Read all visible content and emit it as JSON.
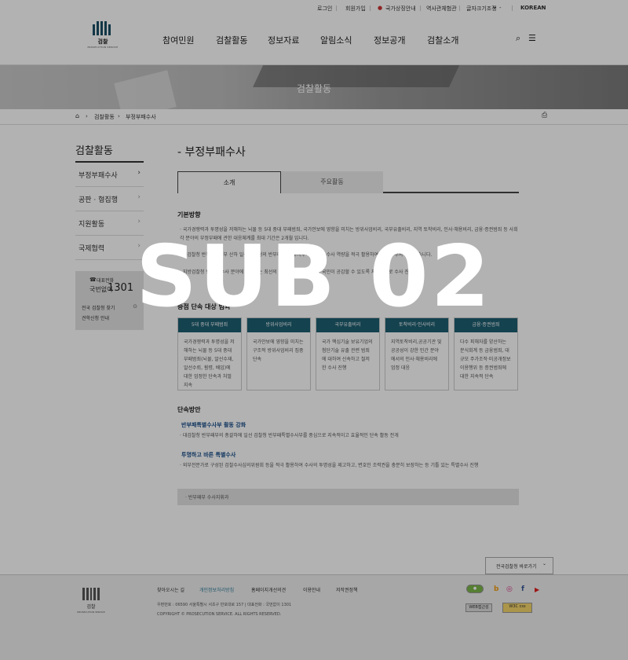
{
  "utility": {
    "login": "로그인",
    "join": "회원가입",
    "flag_icon": "korea-flag-icon",
    "national_info": "국가상징안내",
    "history": "역사관체험관",
    "font_size_label": "글자크기조정",
    "font_plus": "+",
    "font_minus": "-",
    "language": "KOREAN"
  },
  "logo": {
    "name": "검찰",
    "sub": "PROSECUTION SERVICE"
  },
  "gnb": [
    "참여민원",
    "검찰활동",
    "정보자료",
    "알림소식",
    "정보공개",
    "검찰소개"
  ],
  "banner": {
    "title": "검찰활동"
  },
  "breadcrumb": [
    "검찰활동",
    "부정부패수사"
  ],
  "snb": {
    "title": "검찰활동",
    "items": [
      "부정부패수사",
      "공판 · 형집행",
      "지원활동",
      "국제협력"
    ]
  },
  "contact": {
    "label": "대표전화",
    "sublabel": "국번없이",
    "number": "1301",
    "link1": "전국 검찰청 찾기",
    "link2": "견학신청 안내"
  },
  "page": {
    "title": "- 부정부패수사",
    "tabs": [
      "소개",
      "주요활동"
    ]
  },
  "basic": {
    "heading": "기본방향",
    "p1": "· 국가경쟁력과 투명성을 저해하는 뇌물 등 5대 중대 부패범죄, 국가안보에 영향을 미치는 방위사업비리, 국부유출비리, 지역 토착비리, 인사·채용비리, 금융·증권범죄 등 사회 각 분야의 부정부패에 관한 대응체계를 최대 기간은 2개월 입니다.",
    "p2": "· 대검찰청 반부패강력부 산하 일선 검찰청의 반부패 전담 수사부서와 관련 수사 역량을 적극 활용하여 철저히 수사하고 있습니다.",
    "p3": "· 지방검찰청 반부패 수사 분야에 대하여는 최선의 수사 역량을 집중하여 국민이 공감할 수 있도록 지속적으로 수사 진행"
  },
  "crimes": {
    "heading": "중점 단속 대상 범죄",
    "cards": [
      {
        "title": "5대 중대 부패범죄",
        "body": "국가경쟁력과 투명성을 저해하는 뇌물 등 5대 중대 부패범죄(뇌물, 알선수재, 알선수뢰, 횡령, 배임)에 대한 엄정한 단속과 처벌 지속"
      },
      {
        "title": "방위사업비리",
        "body": "국가안보에 영향을 미치는 구조적 방위사업비리 집중 단속"
      },
      {
        "title": "국부유출비리",
        "body": "국가 핵심기술 보유기업의 첨단기술 유출 관련 범죄에 대하여 신속하고 철저한 수사 진행"
      },
      {
        "title": "토착비리·인사비리",
        "body": "지역토착비리,공공기관 및 공공성이 강한 민간 분야에서의 인사·채용비리에 엄정 대응"
      },
      {
        "title": "금융·증권범죄",
        "body": "다수 피해자를 양산하는 분식회계 등 금융범죄, 대규모 주가조작·미공개정보이용행위 등 증권범죄에 대한 지속적 단속"
      }
    ]
  },
  "measures": {
    "heading": "단속방안",
    "h1": "반부패특별수사부 활동 강화",
    "p1": "· 대검찰청 반부패부의 총괄하에 일선 검찰청 반부패특별수사부를 중심으로 지속적이고 효율적인 단속 활동 전개",
    "h2": "투명하고 바른 특별수사",
    "p2": "· 외부전문가로 구성된 검찰수사심의위원회 등을 적극 활용하여 수사의 투명성을 제고하고, 변호인 조력권을 충분히 보장하는 등 기틀 있는 특별수사 진행",
    "note": "· 반부패부 수사지휘과"
  },
  "family_site": "전국검찰청 바로가기",
  "footer": {
    "logo_name": "검찰",
    "logo_sub": "PROSECUTION SERVICE",
    "links": [
      "찾아오시는 길",
      "개인정보처리방침",
      "홈페이지개선의견",
      "이용안내",
      "저작권정책"
    ],
    "address": "우편번호 : 06590 서울특별시 서초구 반포대로 157   |   대표전화 : 국번없이 1301",
    "copyright": "COPYRIGHT © PROSECUTION SERVICE. ALL RIGHTS RESERVED.",
    "sns": [
      "blog-icon",
      "instagram-icon",
      "facebook-icon",
      "youtube-icon"
    ],
    "badges": [
      "WEB접근성",
      "W3C css"
    ]
  },
  "overlay": {
    "text": "SUB 02"
  },
  "colors": {
    "accent": "#1e5f72",
    "link": "#2f7d9a",
    "sub_heading": "#1a4f8a"
  }
}
